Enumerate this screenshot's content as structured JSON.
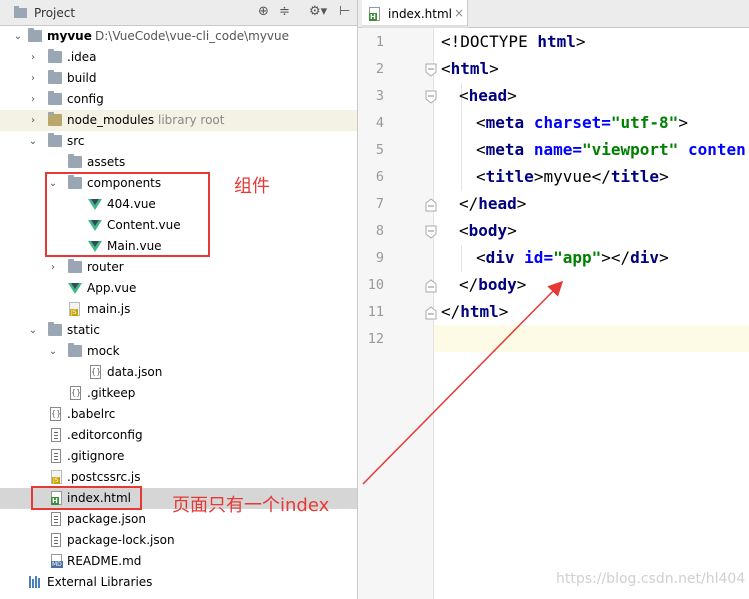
{
  "project_panel": {
    "title": "Project",
    "header_icons": [
      "target-icon",
      "collapse-icon",
      "gear-icon",
      "hide-icon"
    ],
    "tree": [
      {
        "name": "myvue",
        "path": "D:\\VueCode\\vue-cli_code\\myvue",
        "type": "root"
      },
      {
        "name": ".idea",
        "type": "folder"
      },
      {
        "name": "build",
        "type": "folder"
      },
      {
        "name": "config",
        "type": "folder"
      },
      {
        "name": "node_modules",
        "hint": "library root",
        "type": "folder"
      },
      {
        "name": "src",
        "type": "folder"
      },
      {
        "name": "assets",
        "type": "folder"
      },
      {
        "name": "components",
        "type": "folder"
      },
      {
        "name": "404.vue",
        "type": "vue"
      },
      {
        "name": "Content.vue",
        "type": "vue"
      },
      {
        "name": "Main.vue",
        "type": "vue"
      },
      {
        "name": "router",
        "type": "folder"
      },
      {
        "name": "App.vue",
        "type": "vue"
      },
      {
        "name": "main.js",
        "type": "js"
      },
      {
        "name": "static",
        "type": "folder"
      },
      {
        "name": "mock",
        "type": "folder"
      },
      {
        "name": "data.json",
        "type": "json"
      },
      {
        "name": ".gitkeep",
        "type": "json"
      },
      {
        "name": ".babelrc",
        "type": "json"
      },
      {
        "name": ".editorconfig",
        "type": "text"
      },
      {
        "name": ".gitignore",
        "type": "text"
      },
      {
        "name": ".postcssrc.js",
        "type": "js"
      },
      {
        "name": "index.html",
        "type": "html"
      },
      {
        "name": "package.json",
        "type": "text"
      },
      {
        "name": "package-lock.json",
        "type": "text"
      },
      {
        "name": "README.md",
        "type": "md"
      },
      {
        "name": "External Libraries",
        "type": "libraries"
      }
    ]
  },
  "annotations": {
    "components_note": "组件",
    "index_note": "页面只有一个index"
  },
  "editor": {
    "tab_label": "index.html",
    "line_numbers": [
      "1",
      "2",
      "3",
      "4",
      "5",
      "6",
      "7",
      "8",
      "9",
      "10",
      "11",
      "12"
    ],
    "code": {
      "l1a": "<!DOCTYPE ",
      "l1b": "html",
      "l1c": ">",
      "l2a": "<",
      "l2b": "html",
      "l2c": ">",
      "l3a": "<",
      "l3b": "head",
      "l3c": ">",
      "l4a": "<",
      "l4b": "meta ",
      "l4c": "charset=",
      "l4d": "\"utf-8\"",
      "l4e": ">",
      "l5a": "<",
      "l5b": "meta ",
      "l5c": "name=",
      "l5d": "\"viewport\" ",
      "l5e": "conten",
      "l6a": "<",
      "l6b": "title",
      "l6c": ">",
      "l6d": "myvue",
      "l6e": "</",
      "l6f": "title",
      "l6g": ">",
      "l7a": "</",
      "l7b": "head",
      "l7c": ">",
      "l8a": "<",
      "l8b": "body",
      "l8c": ">",
      "l9a": "<",
      "l9b": "div ",
      "l9c": "id=",
      "l9d": "\"app\"",
      "l9e": "></",
      "l9f": "div",
      "l9g": ">",
      "l10a": "</",
      "l10b": "body",
      "l10c": ">",
      "l11a": "</",
      "l11b": "html",
      "l11c": ">"
    }
  },
  "watermark": "https://blog.csdn.net/hl404",
  "colors": {
    "annotation_red": "#e53935",
    "vue_green": "#41b883",
    "tag_navy": "#000080",
    "attr_blue": "#0000ff",
    "string_green": "#008000"
  }
}
